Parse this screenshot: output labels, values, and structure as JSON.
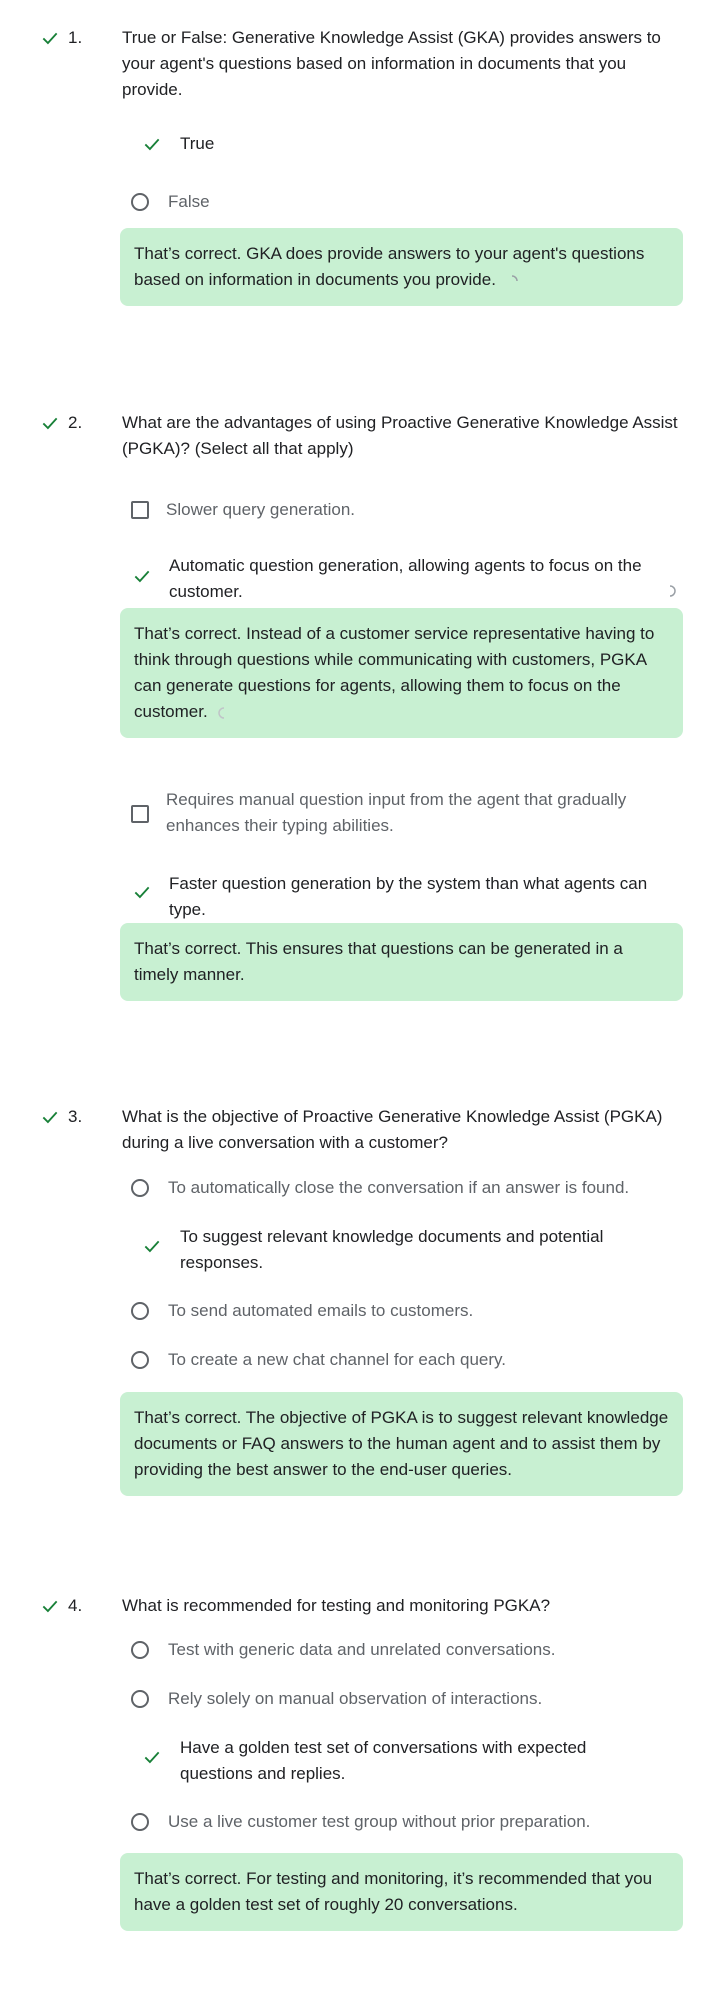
{
  "accent_color": "#188038",
  "feedback_bg": "#c8f0d2",
  "questions": [
    {
      "number": "1.",
      "text": "True or False: Generative Knowledge Assist (GKA) provides answers to your agent's questions based on information in documents that you provide.",
      "options": [
        {
          "label": "True",
          "selected": true
        },
        {
          "label": "False",
          "selected": false
        }
      ],
      "feedback": "That’s correct. GKA does provide answers to your agent's questions based on information in documents you provide."
    },
    {
      "number": "2.",
      "text": "What are the advantages of using Proactive Generative Knowledge Assist (PGKA)? (Select all that apply)",
      "options": [
        {
          "label": "Slower query generation.",
          "selected": false
        },
        {
          "label": "Automatic question generation, allowing agents to focus on the customer.",
          "selected": true,
          "feedback": "That’s correct. Instead of a customer service representative having to think through questions while communicating with customers, PGKA can generate questions for agents, allowing them to focus on the customer."
        },
        {
          "label": "Requires manual question input from the agent that gradually enhances their typing abilities.",
          "selected": false
        },
        {
          "label": "Faster question generation by the system than what agents can type.",
          "selected": true,
          "feedback": "That’s correct. This ensures that questions can be generated in a timely manner."
        }
      ]
    },
    {
      "number": "3.",
      "text": "What is the objective of Proactive Generative Knowledge Assist (PGKA) during a live conversation with a customer?",
      "options": [
        {
          "label": "To automatically close the conversation if an answer is found.",
          "selected": false
        },
        {
          "label": "To suggest relevant knowledge documents and potential responses.",
          "selected": true
        },
        {
          "label": "To send automated emails to customers.",
          "selected": false
        },
        {
          "label": "To create a new chat channel for each query.",
          "selected": false
        }
      ],
      "feedback": "That’s correct. The objective of PGKA is to suggest relevant knowledge documents or FAQ answers to the human agent and to assist them by providing the best answer to the end-user queries."
    },
    {
      "number": "4.",
      "text": "What is recommended for testing and monitoring PGKA?",
      "options": [
        {
          "label": "Test with generic data and unrelated conversations.",
          "selected": false
        },
        {
          "label": "Rely solely on manual observation of interactions.",
          "selected": false
        },
        {
          "label": "Have a golden test set of conversations with expected questions and replies.",
          "selected": true
        },
        {
          "label": "Use a live customer test group without prior preparation.",
          "selected": false
        }
      ],
      "feedback": "That’s correct. For testing and monitoring, it’s recommended that you have a golden test set of roughly 20 conversations."
    }
  ]
}
